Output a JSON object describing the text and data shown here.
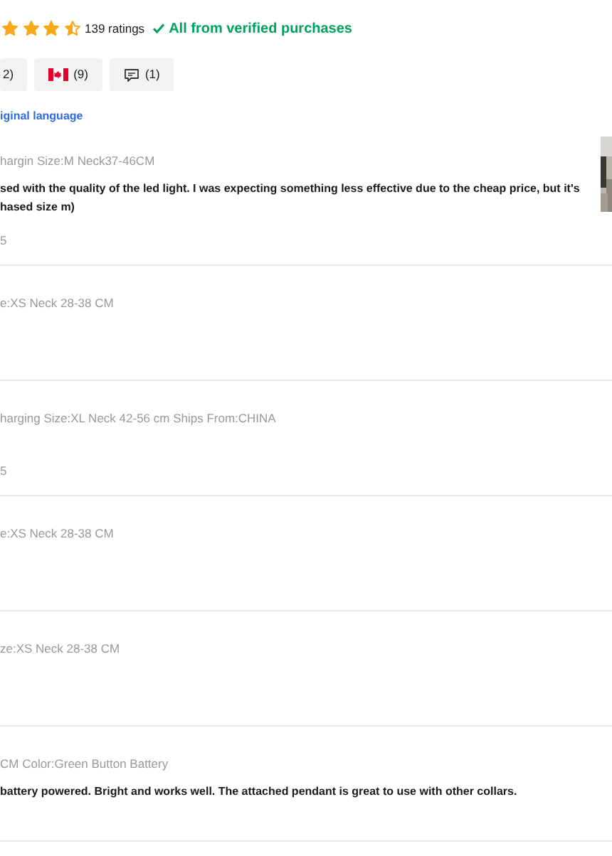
{
  "rating": {
    "stars": 3.5,
    "count": "139 ratings",
    "verified": "All from verified purchases"
  },
  "filters": [
    {
      "kind": "text",
      "label": "2)"
    },
    {
      "kind": "flag",
      "label": "(9)"
    },
    {
      "kind": "comment",
      "label": "(1)"
    }
  ],
  "translate_link": "iginal language",
  "reviews": [
    {
      "meta": "hargin Size:M Neck37-46CM",
      "body": "sed with the quality of the led light. I was expecting something less effective due to the cheap price, but it's hased size m)",
      "date": "5",
      "photo": true
    },
    {
      "meta": "e:XS Neck 28-38 CM"
    },
    {
      "meta": "harging Size:XL Neck 42-56 cm Ships From:CHINA",
      "date": "5"
    },
    {
      "meta": "e:XS Neck 28-38 CM"
    },
    {
      "meta": "ze:XS Neck 28-38 CM"
    },
    {
      "meta": "CM Color:Green Button Battery",
      "body": "battery powered. Bright and works well. The attached pendant is great to use with other collars."
    }
  ]
}
